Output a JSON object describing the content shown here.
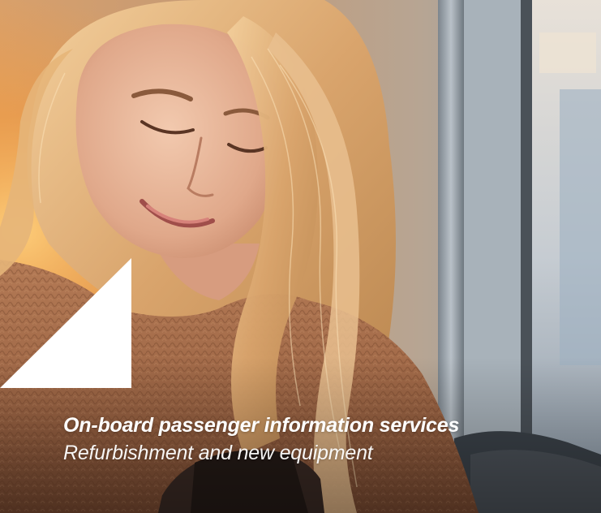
{
  "hero": {
    "title": "On-board passenger information services",
    "subtitle": "Refurbishment and new equipment"
  },
  "colors": {
    "text": "#ffffff",
    "triangle": "#ffffff",
    "sweater": "#a06a48",
    "hair": "#e9c08f",
    "window_frame": "#9aa4ad",
    "sunlight": "#ffb04a"
  }
}
